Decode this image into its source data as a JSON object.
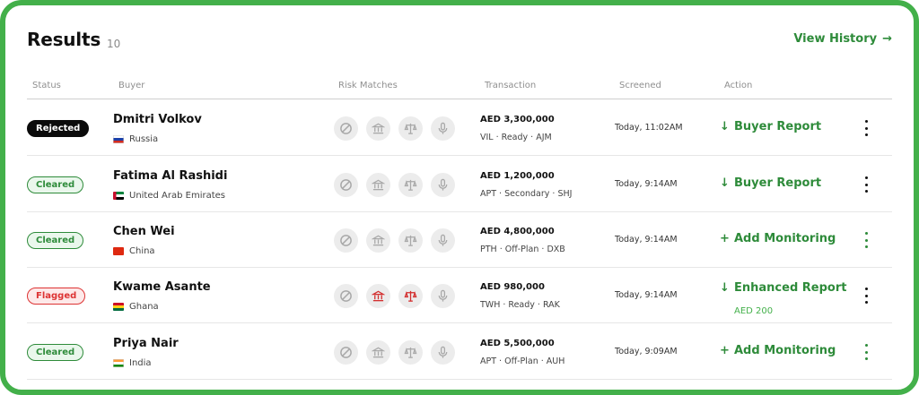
{
  "header": {
    "title": "Results",
    "count": "10",
    "view_history": "View History",
    "arrow": "→"
  },
  "columns": {
    "status": "Status",
    "buyer": "Buyer",
    "risk": "Risk Matches",
    "transaction": "Transaction",
    "screened": "Screened",
    "action": "Action"
  },
  "colors": {
    "accent": "#2e8b3a",
    "frame": "#43b04a",
    "danger": "#d32f2f"
  },
  "rows": [
    {
      "status": "Rejected",
      "status_kind": "rejected",
      "name": "Dmitri Volkov",
      "country": "Russia",
      "flag": "russia-flag",
      "risk_hits": [
        false,
        false,
        false,
        false
      ],
      "amount": "AED 3,300,000",
      "detail": "VIL · Ready · AJM",
      "screened": "Today, 11:02AM",
      "action_symbol": "↓",
      "action": "Buyer Report",
      "price": "",
      "menu_color": "black"
    },
    {
      "status": "Cleared",
      "status_kind": "cleared",
      "name": "Fatima Al Rashidi",
      "country": "United Arab Emirates",
      "flag": "uae-flag",
      "risk_hits": [
        false,
        false,
        false,
        false
      ],
      "amount": "AED 1,200,000",
      "detail": "APT · Secondary · SHJ",
      "screened": "Today, 9:14AM",
      "action_symbol": "↓",
      "action": "Buyer Report",
      "price": "",
      "menu_color": "black"
    },
    {
      "status": "Cleared",
      "status_kind": "cleared",
      "name": "Chen Wei",
      "country": "China",
      "flag": "china-flag",
      "risk_hits": [
        false,
        false,
        false,
        false
      ],
      "amount": "AED 4,800,000",
      "detail": "PTH · Off-Plan · DXB",
      "screened": "Today, 9:14AM",
      "action_symbol": "+",
      "action": "Add Monitoring",
      "price": "",
      "menu_color": "green"
    },
    {
      "status": "Flagged",
      "status_kind": "flagged",
      "name": "Kwame Asante",
      "country": "Ghana",
      "flag": "ghana-flag",
      "risk_hits": [
        false,
        true,
        true,
        false
      ],
      "amount": "AED 980,000",
      "detail": "TWH · Ready · RAK",
      "screened": "Today, 9:14AM",
      "action_symbol": "↓",
      "action": "Enhanced Report",
      "price": "AED 200",
      "menu_color": "black"
    },
    {
      "status": "Cleared",
      "status_kind": "cleared",
      "name": "Priya Nair",
      "country": "India",
      "flag": "india-flag",
      "risk_hits": [
        false,
        false,
        false,
        false
      ],
      "amount": "AED 5,500,000",
      "detail": "APT · Off-Plan · AUH",
      "screened": "Today, 9:09AM",
      "action_symbol": "+",
      "action": "Add Monitoring",
      "price": "",
      "menu_color": "green"
    }
  ]
}
